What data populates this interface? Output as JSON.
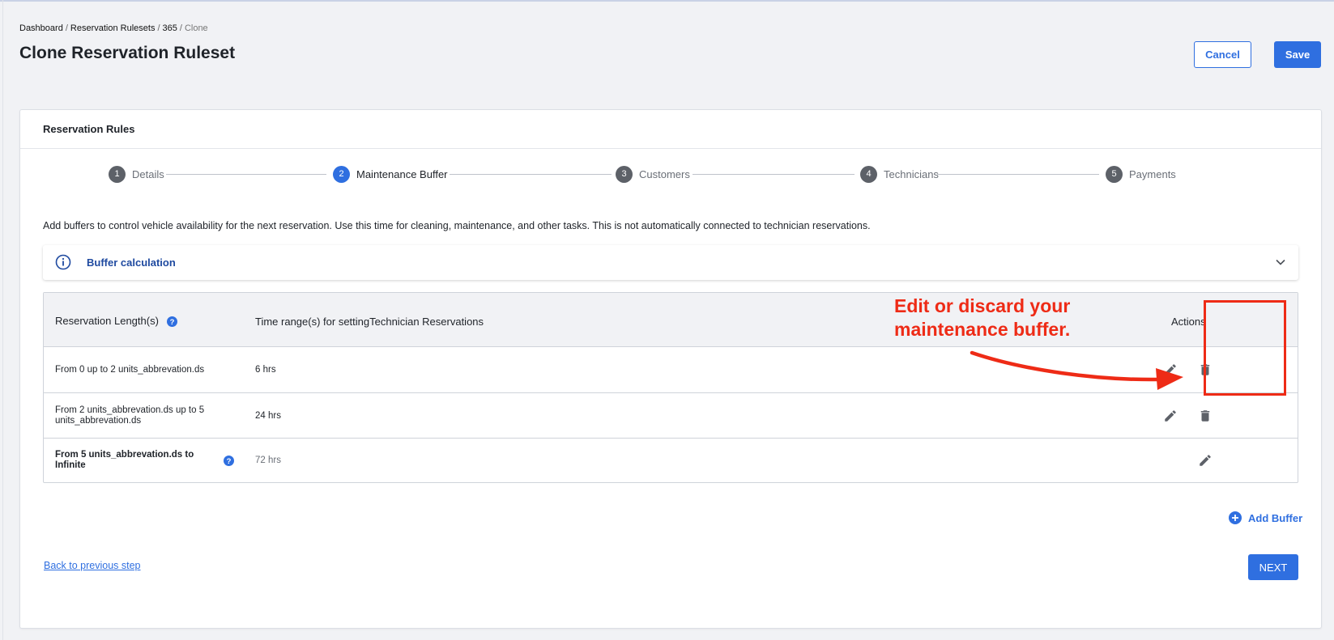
{
  "breadcrumb": {
    "items": [
      "Dashboard",
      "Reservation Rulesets",
      "365"
    ],
    "current": "Clone",
    "separator": "/"
  },
  "page_title": "Clone Reservation Ruleset",
  "header_buttons": {
    "cancel": "Cancel",
    "save": "Save"
  },
  "card": {
    "title": "Reservation Rules",
    "steps": [
      {
        "number": "1",
        "label": "Details",
        "active": false
      },
      {
        "number": "2",
        "label": "Maintenance Buffer",
        "active": true
      },
      {
        "number": "3",
        "label": "Customers",
        "active": false
      },
      {
        "number": "4",
        "label": "Technicians",
        "active": false
      },
      {
        "number": "5",
        "label": "Payments",
        "active": false
      }
    ],
    "description": "Add buffers to control vehicle availability for the next reservation. Use this time for cleaning, maintenance, and other tasks. This is not automatically connected to technician reservations.",
    "accordion": {
      "title": "Buffer calculation",
      "icon": "info-icon"
    },
    "table": {
      "headers": {
        "length": "Reservation Length(s)",
        "time_range": "Time range(s) for settingTechnician Reservations",
        "actions": "Actions"
      },
      "rows": [
        {
          "length": "From 0 up to 2 units_abbrevation.ds",
          "time": "6 hrs",
          "editable": true,
          "deletable": true
        },
        {
          "length": "From 2 units_abbrevation.ds up to 5 units_abbrevation.ds",
          "time": "24 hrs",
          "editable": true,
          "deletable": true
        },
        {
          "length": "From 5 units_abbrevation.ds to Infinite",
          "time": "72 hrs",
          "editable": true,
          "deletable": false
        }
      ]
    },
    "add_buffer": "Add Buffer",
    "back_link": "Back to previous step",
    "next": "NEXT"
  },
  "annotation": {
    "text": "Edit or discard your maintenance buffer.",
    "color": "#ee2b16"
  },
  "colors": {
    "primary": "#2f6fe0",
    "step_inactive": "#5d6168",
    "background": "#f1f2f5"
  }
}
